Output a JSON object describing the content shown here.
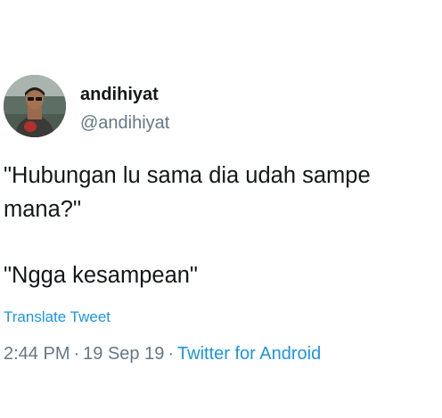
{
  "tweet": {
    "author": {
      "display_name": "andihiyat",
      "handle": "@andihiyat",
      "avatar_icon": "profile-photo"
    },
    "text": [
      "\"Hubungan lu sama dia udah sampe mana?\"",
      "\"Ngga kesampean\""
    ],
    "translate_label": "Translate Tweet",
    "time": "2:44 PM",
    "date": "19 Sep 19",
    "separator": "·",
    "source": "Twitter for Android"
  },
  "colors": {
    "text_primary": "#14171a",
    "text_secondary": "#657786",
    "link": "#1b95e0",
    "background": "#ffffff"
  }
}
